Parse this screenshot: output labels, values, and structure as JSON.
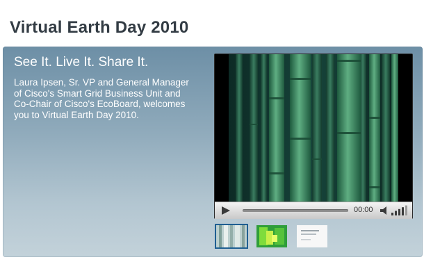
{
  "page": {
    "title": "Virtual Earth Day 2010"
  },
  "feature": {
    "tagline": "See It. Live It. Share It.",
    "description": "Laura Ipsen, Sr. VP and General Manager of Cisco's Smart Grid Business Unit and Co-Chair of Cisco's EcoBoard, welcomes you to Virtual Earth Day 2010."
  },
  "player": {
    "time": "00:00",
    "progress": 0,
    "volume_level_bars": 4,
    "volume_total_bars": 5
  },
  "thumbnails": [
    {
      "id": "bamboo-thumb",
      "selected": true
    },
    {
      "id": "green-graphic-thumb",
      "selected": false
    },
    {
      "id": "document-thumb",
      "selected": false
    }
  ],
  "colors": {
    "title": "#333c44",
    "panel_top": "#6d8fa6",
    "panel_bottom": "#c3d2da",
    "thumb_selected_border": "#1f5f92"
  }
}
